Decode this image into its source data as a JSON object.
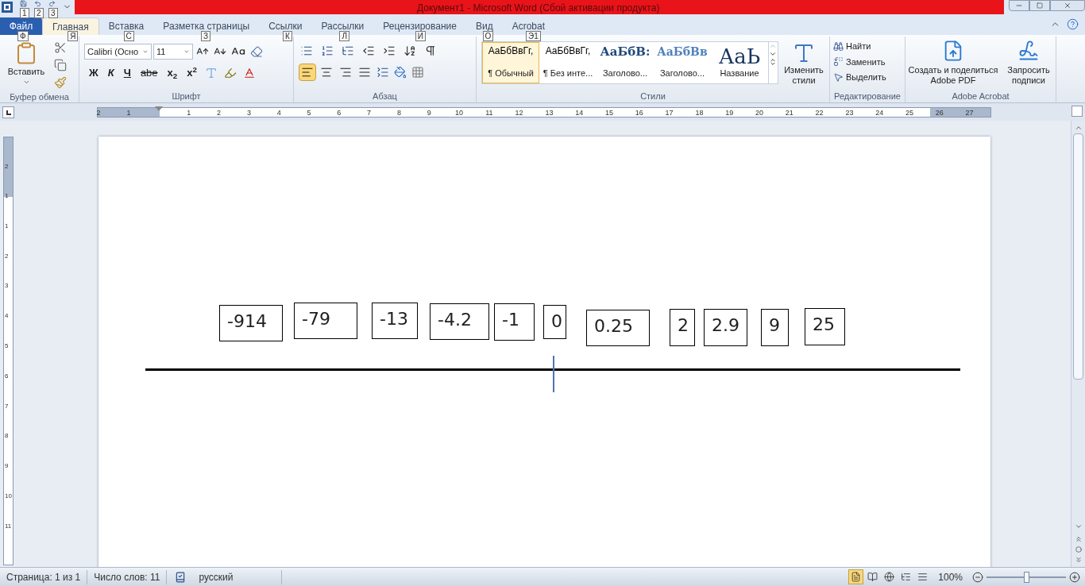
{
  "window": {
    "title": "Документ1  -  Microsoft Word (Сбой активации продукта)"
  },
  "quick_access": [
    {
      "keytip": "1"
    },
    {
      "keytip": "2"
    },
    {
      "keytip": "3"
    }
  ],
  "file_tab": {
    "label": "Файл",
    "keytip": "Ф"
  },
  "tabs": [
    {
      "label": "Главная",
      "keytip": "Я",
      "selected": true
    },
    {
      "label": "Вставка",
      "keytip": "С",
      "selected": false
    },
    {
      "label": "Разметка страницы",
      "keytip": "З",
      "selected": false
    },
    {
      "label": "Ссылки",
      "keytip": "К",
      "selected": false
    },
    {
      "label": "Рассылки",
      "keytip": "Л",
      "selected": false
    },
    {
      "label": "Рецензирование",
      "keytip": "И",
      "selected": false
    },
    {
      "label": "Вид",
      "keytip": "О",
      "selected": false
    },
    {
      "label": "Acrobat",
      "keytip": "Э1",
      "selected": false
    }
  ],
  "clipboard": {
    "label": "Буфер обмена",
    "paste": "Вставить"
  },
  "font": {
    "label": "Шрифт",
    "name": "Calibri (Осно",
    "size": "11",
    "format_buttons": [
      "Ж",
      "К",
      "Ч",
      "abe",
      "x$_{2}$",
      "x$^{2}$"
    ]
  },
  "paragraph": {
    "label": "Абзац",
    "align": [
      {
        "selected": true
      },
      {
        "selected": false
      },
      {
        "selected": false
      },
      {
        "selected": false
      }
    ]
  },
  "styles": {
    "label": "Стили",
    "items": [
      {
        "preview": "АаБбВвГг,",
        "name": "¶ Обычный",
        "selected": true
      },
      {
        "preview": "АаБбВвГг,",
        "name": "¶ Без инте...",
        "selected": false
      },
      {
        "preview": "АаБбВ:",
        "name": "Заголово...",
        "selected": false
      },
      {
        "preview": "АаБбВв",
        "name": "Заголово...",
        "selected": false
      },
      {
        "preview": "АаЬ",
        "name": "Название",
        "selected": false
      }
    ],
    "change": "Изменить стили"
  },
  "editing": {
    "label": "Редактирование",
    "items": [
      "Найти",
      "Заменить",
      "Выделить"
    ]
  },
  "acrobat": {
    "label": "Adobe Acrobat",
    "items": [
      "Создать и поделиться Adobe PDF",
      "Запросить подписи"
    ]
  },
  "ruler": {
    "numbers": [
      "2",
      "1",
      "1",
      "2",
      "3",
      "4",
      "5",
      "6",
      "7",
      "8",
      "9",
      "10",
      "11",
      "12",
      "13",
      "14",
      "15",
      "16",
      "17",
      "18",
      "19",
      "20",
      "21",
      "22",
      "23",
      "24",
      "25",
      "26",
      "27"
    ]
  },
  "vertical_ruler": {
    "numbers": [
      "2",
      "1",
      "1",
      "2",
      "3",
      "4",
      "5",
      "6",
      "7",
      "8",
      "9",
      "10",
      "11"
    ]
  },
  "document": {
    "numbers": [
      "-914",
      "-79",
      "-13",
      "-4.2",
      "-1",
      "0",
      "0.25",
      "2",
      "2.9",
      "9",
      "25"
    ]
  },
  "status_bar": {
    "page": "Страница: 1 из 1",
    "words": "Число слов: 11",
    "language": "русский",
    "views": [
      {
        "selected": true
      },
      {
        "selected": false
      },
      {
        "selected": false
      },
      {
        "selected": false
      },
      {
        "selected": false
      }
    ],
    "zoom": "100%",
    "zoom_slider": {
      "level": 0.5
    }
  }
}
